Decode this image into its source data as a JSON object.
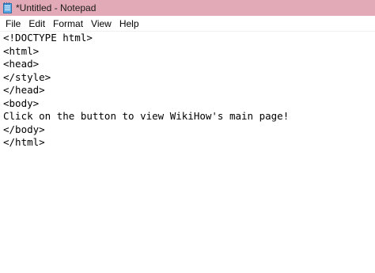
{
  "window": {
    "title": "*Untitled - Notepad",
    "icon": "notepad-icon",
    "titlebar_color": "#e2aab7"
  },
  "menu": {
    "items": [
      {
        "label": "File"
      },
      {
        "label": "Edit"
      },
      {
        "label": "Format"
      },
      {
        "label": "View"
      },
      {
        "label": "Help"
      }
    ]
  },
  "editor": {
    "lines": [
      "<!DOCTYPE html>",
      "<html>",
      "<head>",
      "</style>",
      "</head>",
      "<body>",
      "Click on the button to view WikiHow's main page!",
      "</body>",
      "</html>"
    ]
  }
}
